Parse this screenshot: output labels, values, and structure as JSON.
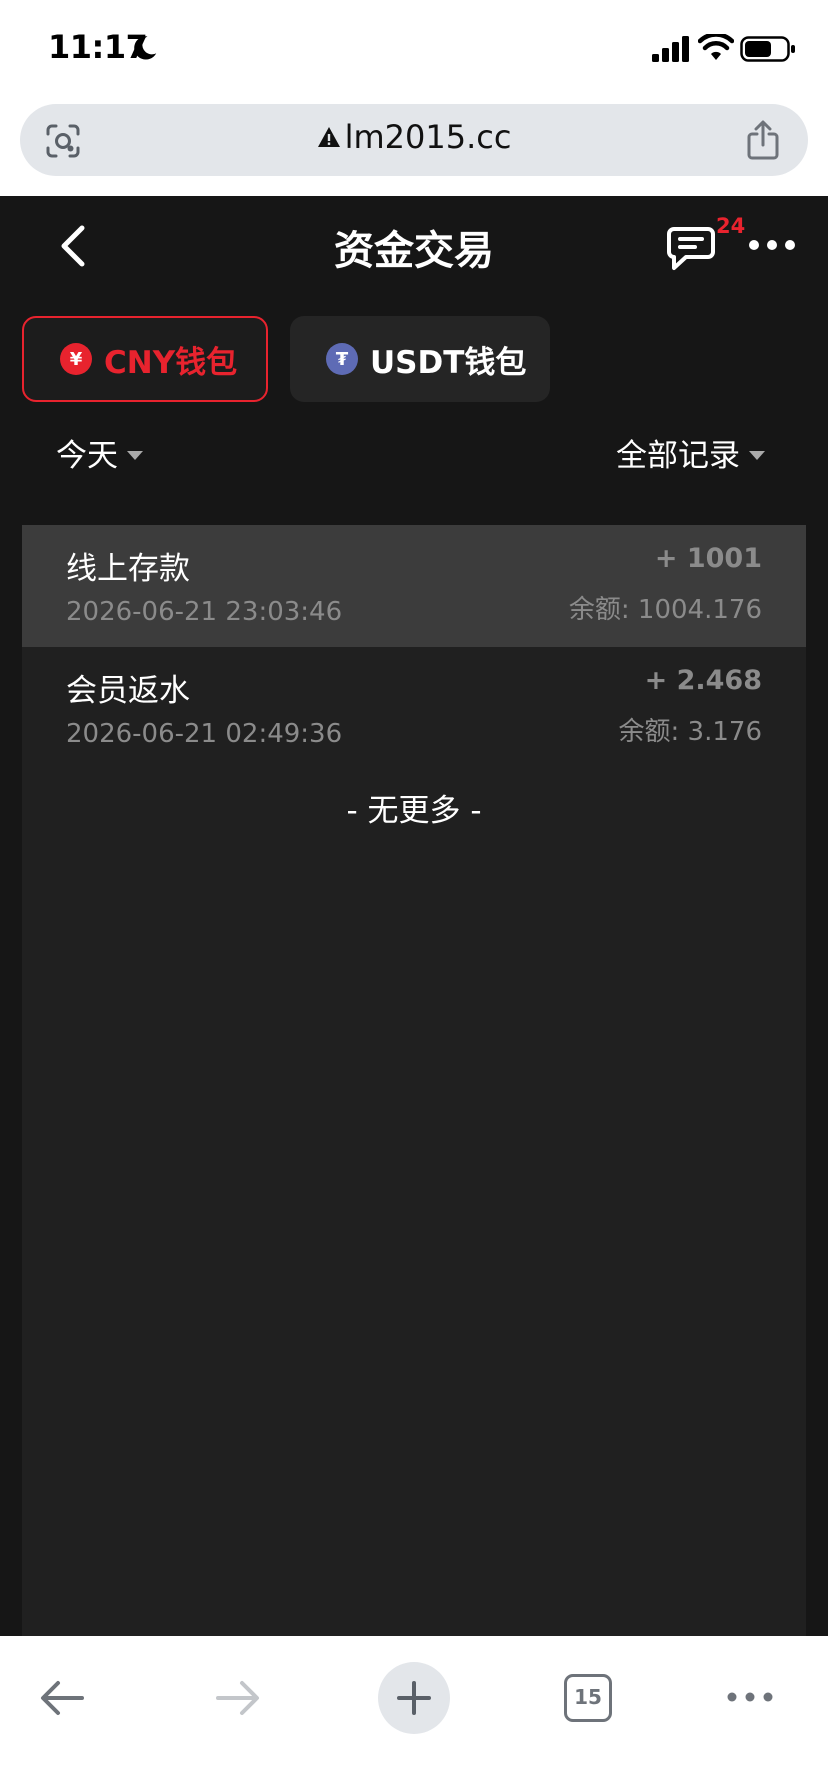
{
  "status_bar": {
    "time": "11:17"
  },
  "browser": {
    "url": "lm2015.cc",
    "tab_count": "15"
  },
  "header": {
    "title": "资金交易",
    "message_badge": "24"
  },
  "wallets": [
    {
      "label": "CNY钱包",
      "coin_symbol": "¥",
      "selected": true
    },
    {
      "label": "USDT钱包",
      "coin_symbol": "₮",
      "selected": false
    }
  ],
  "filters": {
    "date": "今天",
    "type": "全部记录"
  },
  "transactions": [
    {
      "title": "线上存款",
      "date": "2026-06-21 23:03:46",
      "amount": "+ 1001",
      "balance": "余额: 1004.176"
    },
    {
      "title": "会员返水",
      "date": "2026-06-21 02:49:36",
      "amount": "+ 2.468",
      "balance": "余额: 3.176"
    }
  ],
  "list_end_text": "- 无更多 -",
  "colors": {
    "accent": "#e8232e",
    "app_bg": "#161616",
    "list_bg": "#202020",
    "usdt": "#5e6bb5"
  }
}
